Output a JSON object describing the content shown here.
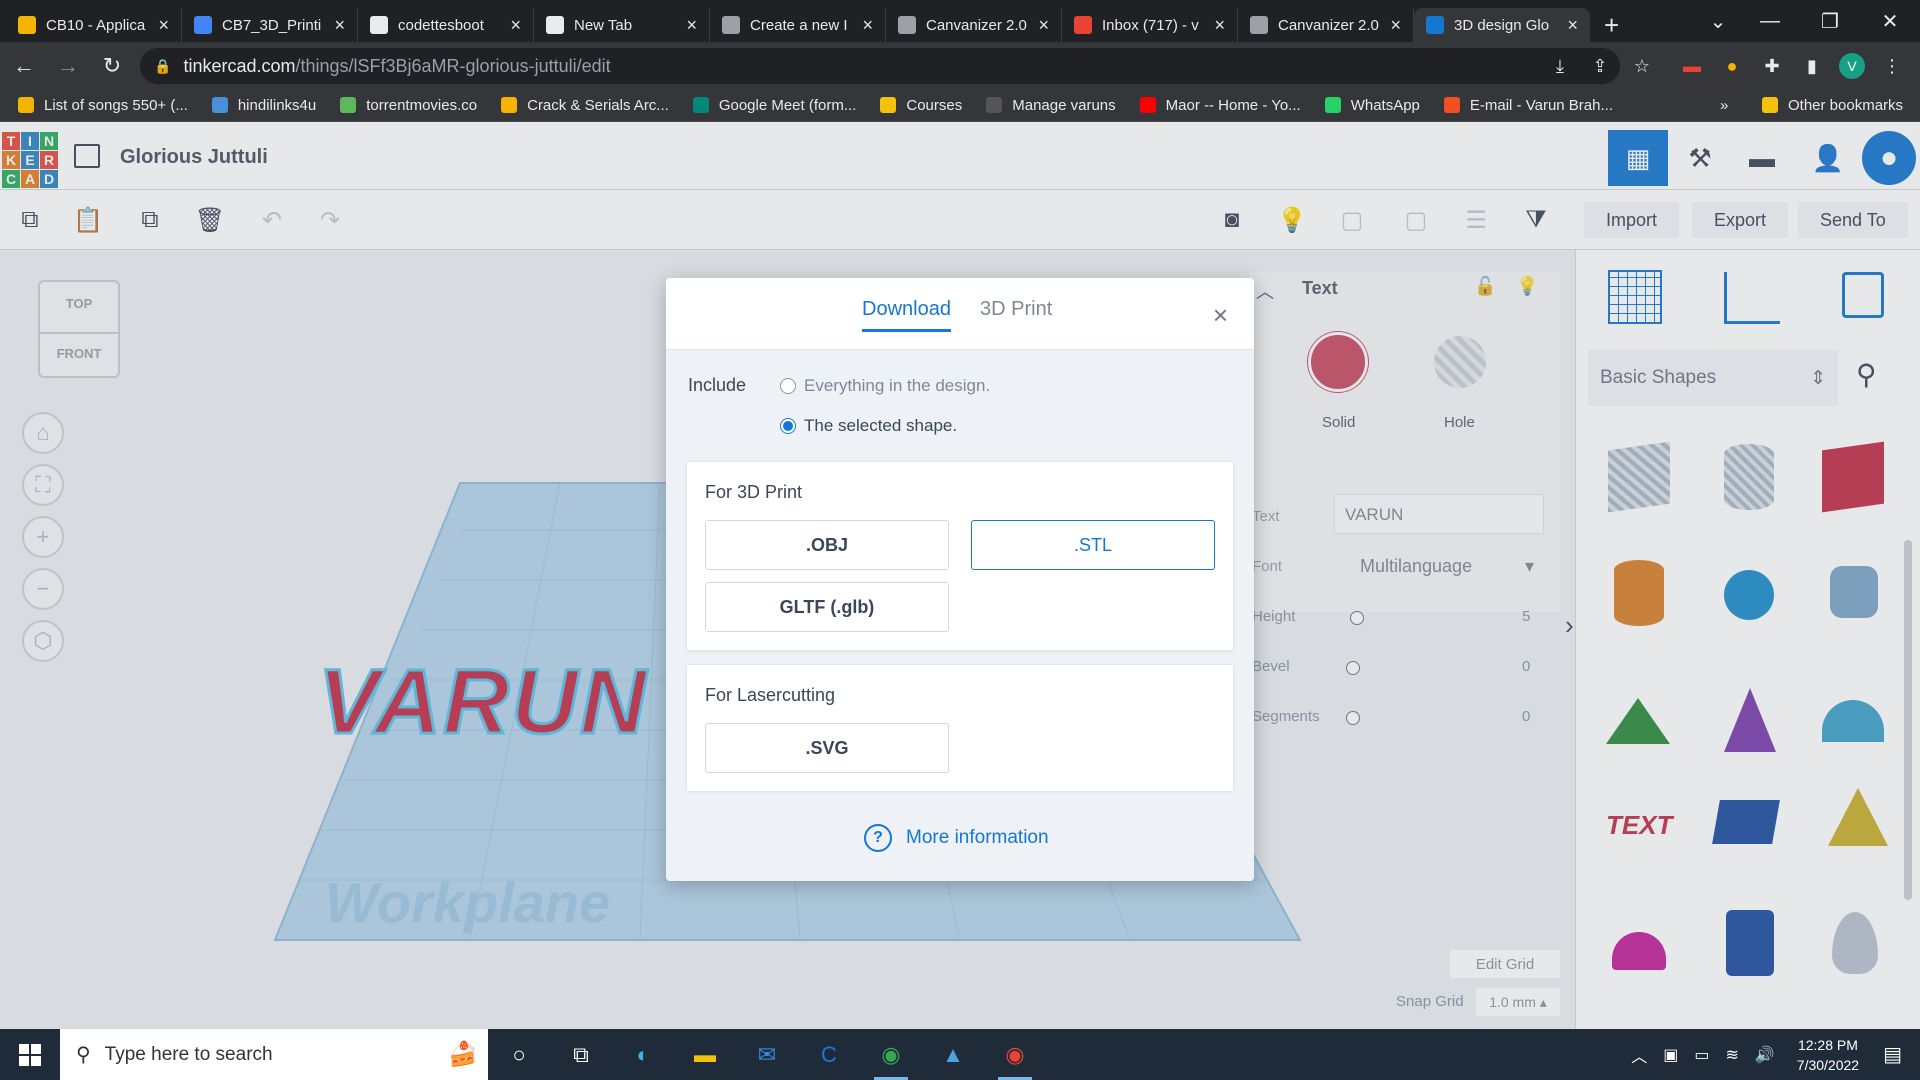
{
  "browser": {
    "tabs": [
      {
        "title": "CB10 - Applica",
        "icon": "slides-icon",
        "color": "#f4b400",
        "active": false
      },
      {
        "title": "CB7_3D_Printi",
        "icon": "docs-icon",
        "color": "#4285f4",
        "active": false
      },
      {
        "title": "codettesboot",
        "icon": "globe-icon",
        "color": "#e8eaed",
        "active": false
      },
      {
        "title": "New Tab",
        "icon": "chrome-icon",
        "color": "#e8eaed",
        "active": false
      },
      {
        "title": "Create a new I",
        "icon": "loading-icon",
        "color": "#9aa0a6",
        "active": false
      },
      {
        "title": "Canvanizer 2.0",
        "icon": "loading-icon",
        "color": "#9aa0a6",
        "active": false
      },
      {
        "title": "Inbox (717) - v",
        "icon": "gmail-icon",
        "color": "#ea4335",
        "active": false
      },
      {
        "title": "Canvanizer 2.0",
        "icon": "loading-icon",
        "color": "#9aa0a6",
        "active": false
      },
      {
        "title": "3D design Glo",
        "icon": "tinkercad-icon",
        "color": "#1477d1",
        "active": true
      }
    ],
    "new_tab": "+",
    "url_host": "tinkercad.com",
    "url_path": "/things/lSFf3Bj6aMR-glorious-juttuli/edit",
    "profile_initial": "V",
    "bookmarks": [
      {
        "label": "List of songs 550+ (...",
        "color": "#f4b400"
      },
      {
        "label": "hindilinks4u",
        "color": "#4a90d9"
      },
      {
        "label": "torrentmovies.co",
        "color": "#5cb85c"
      },
      {
        "label": "Crack & Serials Arc...",
        "color": "#f4b400"
      },
      {
        "label": "Google Meet (form...",
        "color": "#00897b"
      },
      {
        "label": "Courses",
        "color": "#f4c20d"
      },
      {
        "label": "Manage varuns",
        "color": "#555555"
      },
      {
        "label": "Maor -- Home - Yo...",
        "color": "#ff0000"
      },
      {
        "label": "WhatsApp",
        "color": "#25d366"
      },
      {
        "label": "E-mail - Varun Brah...",
        "color": "#f25022"
      }
    ],
    "bookmarks_overflow": "»",
    "other_bookmarks": "Other bookmarks"
  },
  "app": {
    "logo_letters": [
      "T",
      "I",
      "N",
      "K",
      "E",
      "R",
      "C",
      "A",
      "D"
    ],
    "design_title": "Glorious Juttuli",
    "import_label": "Import",
    "export_label": "Export",
    "send_to_label": "Send To",
    "viewcube_top": "TOP",
    "viewcube_front": "FRONT",
    "workplane_label": "Workplane",
    "shape_text": "VARUN",
    "inspector": {
      "title": "Text",
      "solid_label": "Solid",
      "hole_label": "Hole",
      "text_label": "Text",
      "text_value": "VARUN",
      "font_label": "Font",
      "font_value": "Multilanguage",
      "height_label": "Height",
      "height_value": "5",
      "bevel_label": "Bevel",
      "bevel_value": "0",
      "segments_label": "Segments",
      "segments_value": "0"
    },
    "shapes_category": "Basic Shapes",
    "edit_grid": "Edit Grid",
    "snap_grid_label": "Snap Grid",
    "snap_grid_value": "1.0 mm"
  },
  "modal": {
    "tab_download": "Download",
    "tab_3dprint": "3D Print",
    "close": "×",
    "include_label": "Include",
    "option_everything": "Everything in the design.",
    "option_selected": "The selected shape.",
    "selected_option": "The selected shape.",
    "section_3dprint": "For 3D Print",
    "btn_obj": ".OBJ",
    "btn_stl": ".STL",
    "btn_gltf": "GLTF (.glb)",
    "section_laser": "For Lasercutting",
    "btn_svg": ".SVG",
    "more_info": "More information"
  },
  "taskbar": {
    "search_placeholder": "Type here to search",
    "time": "12:28 PM",
    "date": "7/30/2022"
  }
}
